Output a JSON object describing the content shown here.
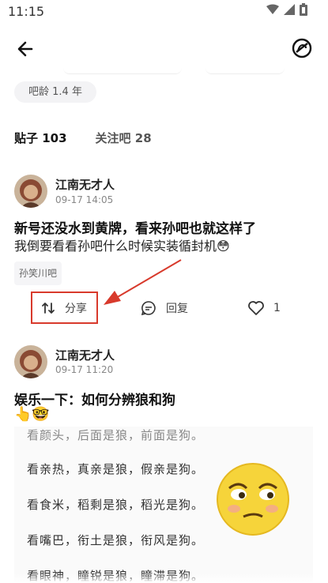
{
  "status_bar": {
    "time": "11:15",
    "icons": [
      "wifi-icon",
      "signal-icon",
      "battery-icon"
    ]
  },
  "header": {
    "back_icon": "arrow-left-icon",
    "block_icon": "block-user-icon"
  },
  "profile": {
    "tieba_age": "吧龄 1.4 年"
  },
  "tabs": [
    {
      "label": "贴子 103",
      "active": true
    },
    {
      "label": "关注吧 28",
      "active": false
    }
  ],
  "posts": [
    {
      "author": "江南无才人",
      "time": "09-17 14:05",
      "title": "新号还没水到黄牌，看来孙吧也就这样了",
      "body": "我倒要看看孙吧什么时候实装循封机😳",
      "forum": "孙笑川吧",
      "share_label": "分享",
      "reply_label": "回复",
      "like_count": "1"
    },
    {
      "author": "江南无才人",
      "time": "09-17 11:20",
      "title": "娱乐一下：如何分辨狼和狗",
      "body": "👆🤓",
      "image_lines": [
        "看颜头，后面是狼，前面是狗。",
        "看亲热，真亲是狼，假亲是狗。",
        "看食米，稻剩是狼，稻光是狗。",
        "看嘴巴，衔土是狼，衔风是狗。",
        "看眼神，瞳锐是狼，瞳滞是狗。"
      ]
    }
  ],
  "colors": {
    "highlight": "#d83a2c",
    "accent_arrow": "#d83a2c"
  }
}
